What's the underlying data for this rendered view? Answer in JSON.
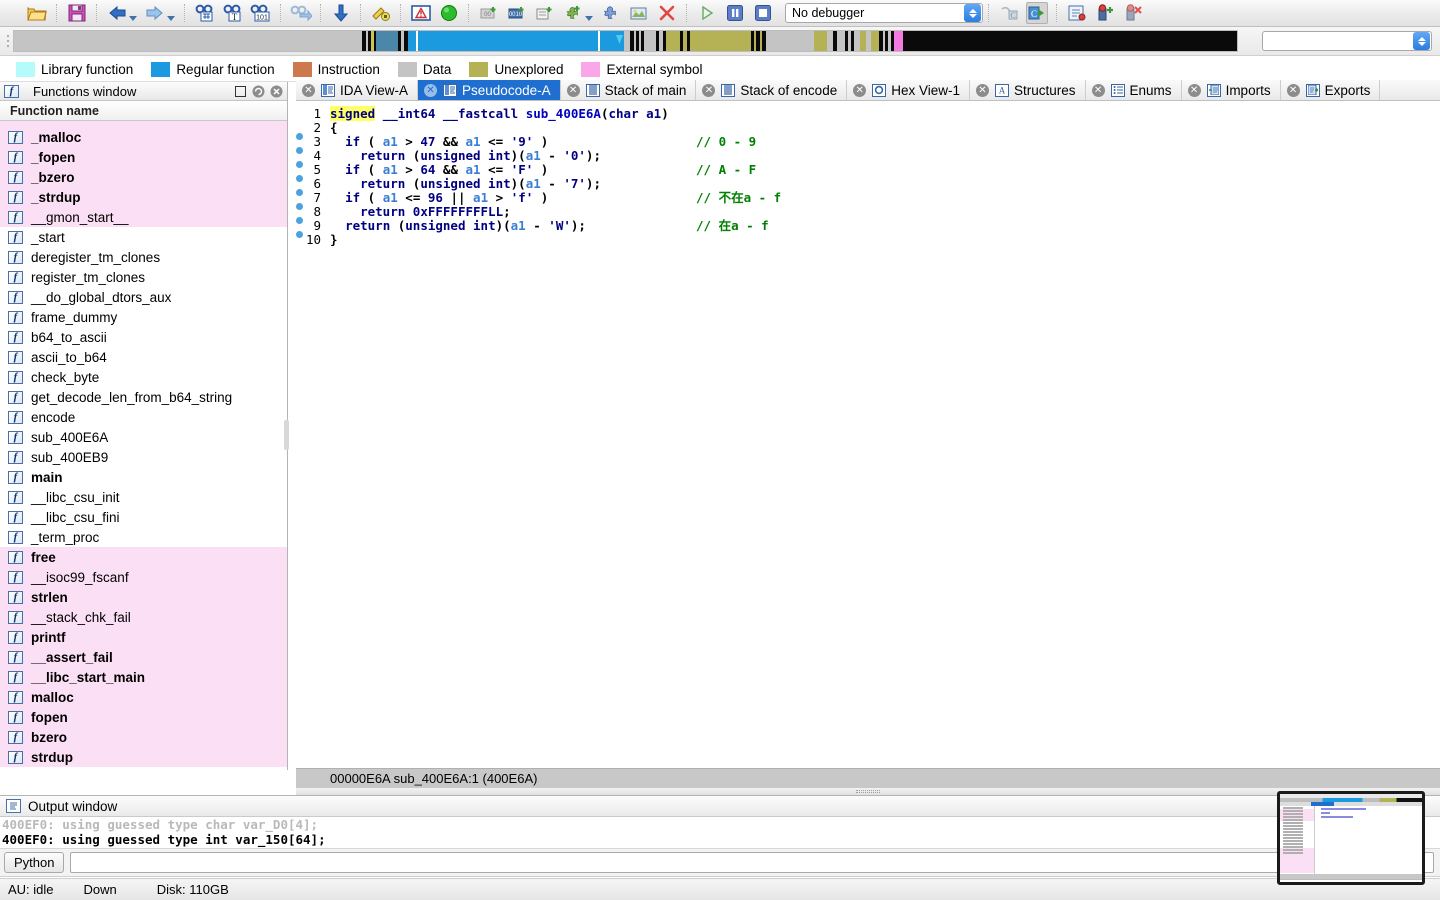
{
  "toolbar": {
    "icons": [
      {
        "name": "open-file-icon",
        "glyph": "folder"
      },
      {
        "name": "save-icon",
        "glyph": "save"
      },
      {
        "name": "back-icon",
        "glyph": "arrow-left"
      },
      {
        "name": "forward-icon",
        "glyph": "arrow-right"
      },
      {
        "name": "search-binary-icon",
        "glyph": "binoc-hash"
      },
      {
        "name": "search-text-icon",
        "glyph": "binoc-T"
      },
      {
        "name": "search-sequence-icon",
        "glyph": "binoc-101"
      },
      {
        "name": "jump-to-xref-icon",
        "glyph": "binoc-arrow"
      },
      {
        "name": "jump-down-icon",
        "glyph": "arrow-down"
      },
      {
        "name": "produce-file-icon",
        "glyph": "key-pencil"
      },
      {
        "name": "warnings-icon",
        "glyph": "alert"
      },
      {
        "name": "run-to-cursor-icon",
        "glyph": "green-circle"
      },
      {
        "name": "hex-dump-icon",
        "glyph": "hex-new"
      },
      {
        "name": "goto-icon",
        "glyph": "goto-new"
      },
      {
        "name": "structure-icon",
        "glyph": "struct-new"
      },
      {
        "name": "add-breakpoint-icon",
        "glyph": "puzzle-plus"
      },
      {
        "name": "plugins-icon",
        "glyph": "puzzle"
      },
      {
        "name": "screenshot-icon",
        "glyph": "picture"
      },
      {
        "name": "delete-icon",
        "glyph": "red-x"
      },
      {
        "name": "run-icon",
        "glyph": "play"
      },
      {
        "name": "pause-icon",
        "glyph": "pause"
      },
      {
        "name": "stop-icon",
        "glyph": "stop"
      }
    ],
    "icons_right": [
      {
        "name": "step-into-icon",
        "glyph": "step-c"
      },
      {
        "name": "step-over-icon",
        "glyph": "step-c-arrow"
      },
      {
        "name": "breakpoint-list-icon",
        "glyph": "bp-list"
      },
      {
        "name": "add-bp-icon",
        "glyph": "bp-add"
      },
      {
        "name": "del-bp-icon",
        "glyph": "bp-del"
      }
    ],
    "debugger_select": {
      "value": "No debugger",
      "name": "debugger-selector"
    }
  },
  "navband": {
    "name": "navigation-band",
    "segments": [
      {
        "color": "#c4c4c4",
        "width": 30.6
      },
      {
        "color": "#0a0a0a",
        "width": 0.3
      },
      {
        "color": "#c4c4c4",
        "width": 0.18
      },
      {
        "color": "#0a0a0a",
        "width": 0.3
      },
      {
        "color": "#ccc44f",
        "width": 0.22
      },
      {
        "color": "#0a0a0a",
        "width": 0.25
      },
      {
        "color": "#4a87a8",
        "width": 1.9
      },
      {
        "color": "#0a0a0a",
        "width": 0.3
      },
      {
        "color": "#c4c4c4",
        "width": 0.22
      },
      {
        "color": "#0a0a0a",
        "width": 0.4
      },
      {
        "color": "#1b9ae0",
        "width": 0.65
      },
      {
        "color": "#ffffff",
        "width": 0.22
      },
      {
        "color": "#1b9ae0",
        "width": 15.8
      },
      {
        "color": "#ffffff",
        "width": 0.18
      },
      {
        "color": "#1b9ae0",
        "width": 2.1
      },
      {
        "color": "#c4c4c4",
        "width": 0.55
      },
      {
        "color": "#0a0a0a",
        "width": 0.28
      },
      {
        "color": "#c4c4c4",
        "width": 0.2
      },
      {
        "color": "#0a0a0a",
        "width": 0.28
      },
      {
        "color": "#c4c4c4",
        "width": 0.2
      },
      {
        "color": "#0a0a0a",
        "width": 0.28
      },
      {
        "color": "#c4c4c4",
        "width": 1.0
      },
      {
        "color": "#0a0a0a",
        "width": 0.3
      },
      {
        "color": "#c4c4c4",
        "width": 0.3
      },
      {
        "color": "#0a0a0a",
        "width": 0.3
      },
      {
        "color": "#b5b255",
        "width": 1.2
      },
      {
        "color": "#0a0a0a",
        "width": 0.3
      },
      {
        "color": "#b5b255",
        "width": 0.35
      },
      {
        "color": "#0a0a0a",
        "width": 0.3
      },
      {
        "color": "#b5b255",
        "width": 5.3
      },
      {
        "color": "#0a0a0a",
        "width": 0.3
      },
      {
        "color": "#b5b255",
        "width": 0.2
      },
      {
        "color": "#0a0a0a",
        "width": 0.3
      },
      {
        "color": "#b5b255",
        "width": 0.2
      },
      {
        "color": "#0a0a0a",
        "width": 0.3
      },
      {
        "color": "#c4c4c4",
        "width": 4.3
      },
      {
        "color": "#b5b255",
        "width": 1.1
      },
      {
        "color": "#c4c4c4",
        "width": 0.5
      },
      {
        "color": "#0a0a0a",
        "width": 0.35
      },
      {
        "color": "#c4c4c4",
        "width": 0.7
      },
      {
        "color": "#0a0a0a",
        "width": 0.3
      },
      {
        "color": "#c4c4c4",
        "width": 0.25
      },
      {
        "color": "#0a0a0a",
        "width": 0.3
      },
      {
        "color": "#c4c4c4",
        "width": 0.5
      },
      {
        "color": "#b5b255",
        "width": 0.5
      },
      {
        "color": "#c4c4c4",
        "width": 0.5
      },
      {
        "color": "#b5b255",
        "width": 0.7
      },
      {
        "color": "#0a0a0a",
        "width": 0.3
      },
      {
        "color": "#c4c4c4",
        "width": 0.2
      },
      {
        "color": "#0a0a0a",
        "width": 0.3
      },
      {
        "color": "#c4c4c4",
        "width": 0.2
      },
      {
        "color": "#0a0a0a",
        "width": 0.3
      },
      {
        "color": "#f47ae0",
        "width": 0.75
      },
      {
        "color": "#0a0a0a",
        "width": 29.4
      }
    ],
    "cursor_pos_pct": 49.2
  },
  "search": {
    "name": "quick-search-input",
    "value": "",
    "placeholder": ""
  },
  "legend": {
    "name": "color-legend",
    "items": [
      {
        "label": "Library function",
        "color": "#b4fbfb"
      },
      {
        "label": "Regular function",
        "color": "#1b9ae0"
      },
      {
        "label": "Instruction",
        "color": "#cc7a4d"
      },
      {
        "label": "Data",
        "color": "#c4c4c4"
      },
      {
        "label": "Unexplored",
        "color": "#b5b255"
      },
      {
        "label": "External symbol",
        "color": "#f9a7e8"
      }
    ]
  },
  "functions_window": {
    "title": "Functions window",
    "column_header": "Function name",
    "items": [
      {
        "name": "_malloc",
        "library": true,
        "bold": true
      },
      {
        "name": "_fopen",
        "library": true,
        "bold": true
      },
      {
        "name": "_bzero",
        "library": true,
        "bold": true
      },
      {
        "name": "_strdup",
        "library": true,
        "bold": true
      },
      {
        "name": "__gmon_start__",
        "library": true,
        "bold": false
      },
      {
        "name": "_start",
        "library": false,
        "bold": false
      },
      {
        "name": "deregister_tm_clones",
        "library": false,
        "bold": false
      },
      {
        "name": "register_tm_clones",
        "library": false,
        "bold": false
      },
      {
        "name": "__do_global_dtors_aux",
        "library": false,
        "bold": false
      },
      {
        "name": "frame_dummy",
        "library": false,
        "bold": false
      },
      {
        "name": "b64_to_ascii",
        "library": false,
        "bold": false
      },
      {
        "name": "ascii_to_b64",
        "library": false,
        "bold": false
      },
      {
        "name": "check_byte",
        "library": false,
        "bold": false
      },
      {
        "name": "get_decode_len_from_b64_string",
        "library": false,
        "bold": false
      },
      {
        "name": "encode",
        "library": false,
        "bold": false
      },
      {
        "name": "sub_400E6A",
        "library": false,
        "bold": false
      },
      {
        "name": "sub_400EB9",
        "library": false,
        "bold": false
      },
      {
        "name": "main",
        "library": false,
        "bold": true
      },
      {
        "name": "__libc_csu_init",
        "library": false,
        "bold": false
      },
      {
        "name": "__libc_csu_fini",
        "library": false,
        "bold": false
      },
      {
        "name": "_term_proc",
        "library": false,
        "bold": false
      },
      {
        "name": "free",
        "library": true,
        "bold": true
      },
      {
        "name": "__isoc99_fscanf",
        "library": true,
        "bold": false
      },
      {
        "name": "strlen",
        "library": true,
        "bold": true
      },
      {
        "name": "__stack_chk_fail",
        "library": true,
        "bold": false
      },
      {
        "name": "printf",
        "library": true,
        "bold": true
      },
      {
        "name": "__assert_fail",
        "library": true,
        "bold": true
      },
      {
        "name": "__libc_start_main",
        "library": true,
        "bold": true
      },
      {
        "name": "malloc",
        "library": true,
        "bold": true
      },
      {
        "name": "fopen",
        "library": true,
        "bold": true
      },
      {
        "name": "bzero",
        "library": true,
        "bold": true
      },
      {
        "name": "strdup",
        "library": true,
        "bold": true
      }
    ]
  },
  "tabs": [
    {
      "label": "IDA View-A",
      "icon": "ida-view-icon",
      "active": false
    },
    {
      "label": "Pseudocode-A",
      "icon": "pseudocode-icon",
      "active": true
    },
    {
      "label": "Stack of main",
      "icon": "stack-icon",
      "active": false
    },
    {
      "label": "Stack of encode",
      "icon": "stack-icon",
      "active": false
    },
    {
      "label": "Hex View-1",
      "icon": "hex-view-icon",
      "active": false
    },
    {
      "label": "Structures",
      "icon": "structures-icon",
      "active": false
    },
    {
      "label": "Enums",
      "icon": "enums-icon",
      "active": false
    },
    {
      "label": "Imports",
      "icon": "imports-icon",
      "active": false
    },
    {
      "label": "Exports",
      "icon": "exports-icon",
      "active": false
    }
  ],
  "pseudocode": {
    "lines": [
      {
        "num": "1",
        "dot": false,
        "tokens": [
          {
            "t": "signed",
            "c": "hl"
          },
          {
            "t": " ",
            "c": "pun"
          },
          {
            "t": "__int64",
            "c": "k"
          },
          {
            "t": " ",
            "c": "pun"
          },
          {
            "t": "__fastcall",
            "c": "k"
          },
          {
            "t": " ",
            "c": "pun"
          },
          {
            "t": "sub_400E6A",
            "c": "id"
          },
          {
            "t": "(",
            "c": "pun"
          },
          {
            "t": "char",
            "c": "k"
          },
          {
            "t": " ",
            "c": "pun"
          },
          {
            "t": "a1",
            "c": "k"
          },
          {
            "t": ")",
            "c": "pun"
          }
        ],
        "comment": ""
      },
      {
        "num": "2",
        "dot": false,
        "tokens": [
          {
            "t": "{",
            "c": "pun"
          }
        ],
        "comment": ""
      },
      {
        "num": "3",
        "dot": true,
        "tokens": [
          {
            "t": "  ",
            "c": "pun"
          },
          {
            "t": "if",
            "c": "k"
          },
          {
            "t": " ( ",
            "c": "pun"
          },
          {
            "t": "a1",
            "c": "var"
          },
          {
            "t": " > ",
            "c": "pun"
          },
          {
            "t": "47",
            "c": "num"
          },
          {
            "t": " && ",
            "c": "pun"
          },
          {
            "t": "a1",
            "c": "var"
          },
          {
            "t": " <= ",
            "c": "pun"
          },
          {
            "t": "'9'",
            "c": "num"
          },
          {
            "t": " )",
            "c": "pun"
          }
        ],
        "comment": "// 0 - 9"
      },
      {
        "num": "4",
        "dot": true,
        "tokens": [
          {
            "t": "    ",
            "c": "pun"
          },
          {
            "t": "return",
            "c": "k"
          },
          {
            "t": " (",
            "c": "pun"
          },
          {
            "t": "unsigned int",
            "c": "k"
          },
          {
            "t": ")(",
            "c": "pun"
          },
          {
            "t": "a1",
            "c": "var"
          },
          {
            "t": " - ",
            "c": "pun"
          },
          {
            "t": "'0'",
            "c": "num"
          },
          {
            "t": ");",
            "c": "pun"
          }
        ],
        "comment": ""
      },
      {
        "num": "5",
        "dot": true,
        "tokens": [
          {
            "t": "  ",
            "c": "pun"
          },
          {
            "t": "if",
            "c": "k"
          },
          {
            "t": " ( ",
            "c": "pun"
          },
          {
            "t": "a1",
            "c": "var"
          },
          {
            "t": " > ",
            "c": "pun"
          },
          {
            "t": "64",
            "c": "num"
          },
          {
            "t": " && ",
            "c": "pun"
          },
          {
            "t": "a1",
            "c": "var"
          },
          {
            "t": " <= ",
            "c": "pun"
          },
          {
            "t": "'F'",
            "c": "num"
          },
          {
            "t": " )",
            "c": "pun"
          }
        ],
        "comment": "// A - F"
      },
      {
        "num": "6",
        "dot": true,
        "tokens": [
          {
            "t": "    ",
            "c": "pun"
          },
          {
            "t": "return",
            "c": "k"
          },
          {
            "t": " (",
            "c": "pun"
          },
          {
            "t": "unsigned int",
            "c": "k"
          },
          {
            "t": ")(",
            "c": "pun"
          },
          {
            "t": "a1",
            "c": "var"
          },
          {
            "t": " - ",
            "c": "pun"
          },
          {
            "t": "'7'",
            "c": "num"
          },
          {
            "t": ");",
            "c": "pun"
          }
        ],
        "comment": ""
      },
      {
        "num": "7",
        "dot": true,
        "tokens": [
          {
            "t": "  ",
            "c": "pun"
          },
          {
            "t": "if",
            "c": "k"
          },
          {
            "t": " ( ",
            "c": "pun"
          },
          {
            "t": "a1",
            "c": "var"
          },
          {
            "t": " <= ",
            "c": "pun"
          },
          {
            "t": "96",
            "c": "num"
          },
          {
            "t": " || ",
            "c": "pun"
          },
          {
            "t": "a1",
            "c": "var"
          },
          {
            "t": " > ",
            "c": "pun"
          },
          {
            "t": "'f'",
            "c": "num"
          },
          {
            "t": " )",
            "c": "pun"
          }
        ],
        "comment": "// 不在a - f"
      },
      {
        "num": "8",
        "dot": true,
        "tokens": [
          {
            "t": "    ",
            "c": "pun"
          },
          {
            "t": "return",
            "c": "k"
          },
          {
            "t": " ",
            "c": "pun"
          },
          {
            "t": "0xFFFFFFFFLL",
            "c": "num"
          },
          {
            "t": ";",
            "c": "pun"
          }
        ],
        "comment": ""
      },
      {
        "num": "9",
        "dot": true,
        "tokens": [
          {
            "t": "  ",
            "c": "pun"
          },
          {
            "t": "return",
            "c": "k"
          },
          {
            "t": " (",
            "c": "pun"
          },
          {
            "t": "unsigned int",
            "c": "k"
          },
          {
            "t": ")(",
            "c": "pun"
          },
          {
            "t": "a1",
            "c": "var"
          },
          {
            "t": " - ",
            "c": "pun"
          },
          {
            "t": "'W'",
            "c": "num"
          },
          {
            "t": ");",
            "c": "pun"
          }
        ],
        "comment": "// 在a - f"
      },
      {
        "num": "10",
        "dot": true,
        "tokens": [
          {
            "t": "}",
            "c": "pun"
          }
        ],
        "comment": ""
      }
    ],
    "status": "00000E6A  sub_400E6A:1 (400E6A)"
  },
  "output_window": {
    "title": "Output window",
    "lines": [
      "400EF0: using guessed type char var_D0[4];",
      "400EF0: using guessed type int var_150[64];"
    ],
    "python_button": "Python",
    "python_input_value": ""
  },
  "statusbar": {
    "au": "AU: idle",
    "down": "Down",
    "disk": "Disk: 110GB"
  }
}
